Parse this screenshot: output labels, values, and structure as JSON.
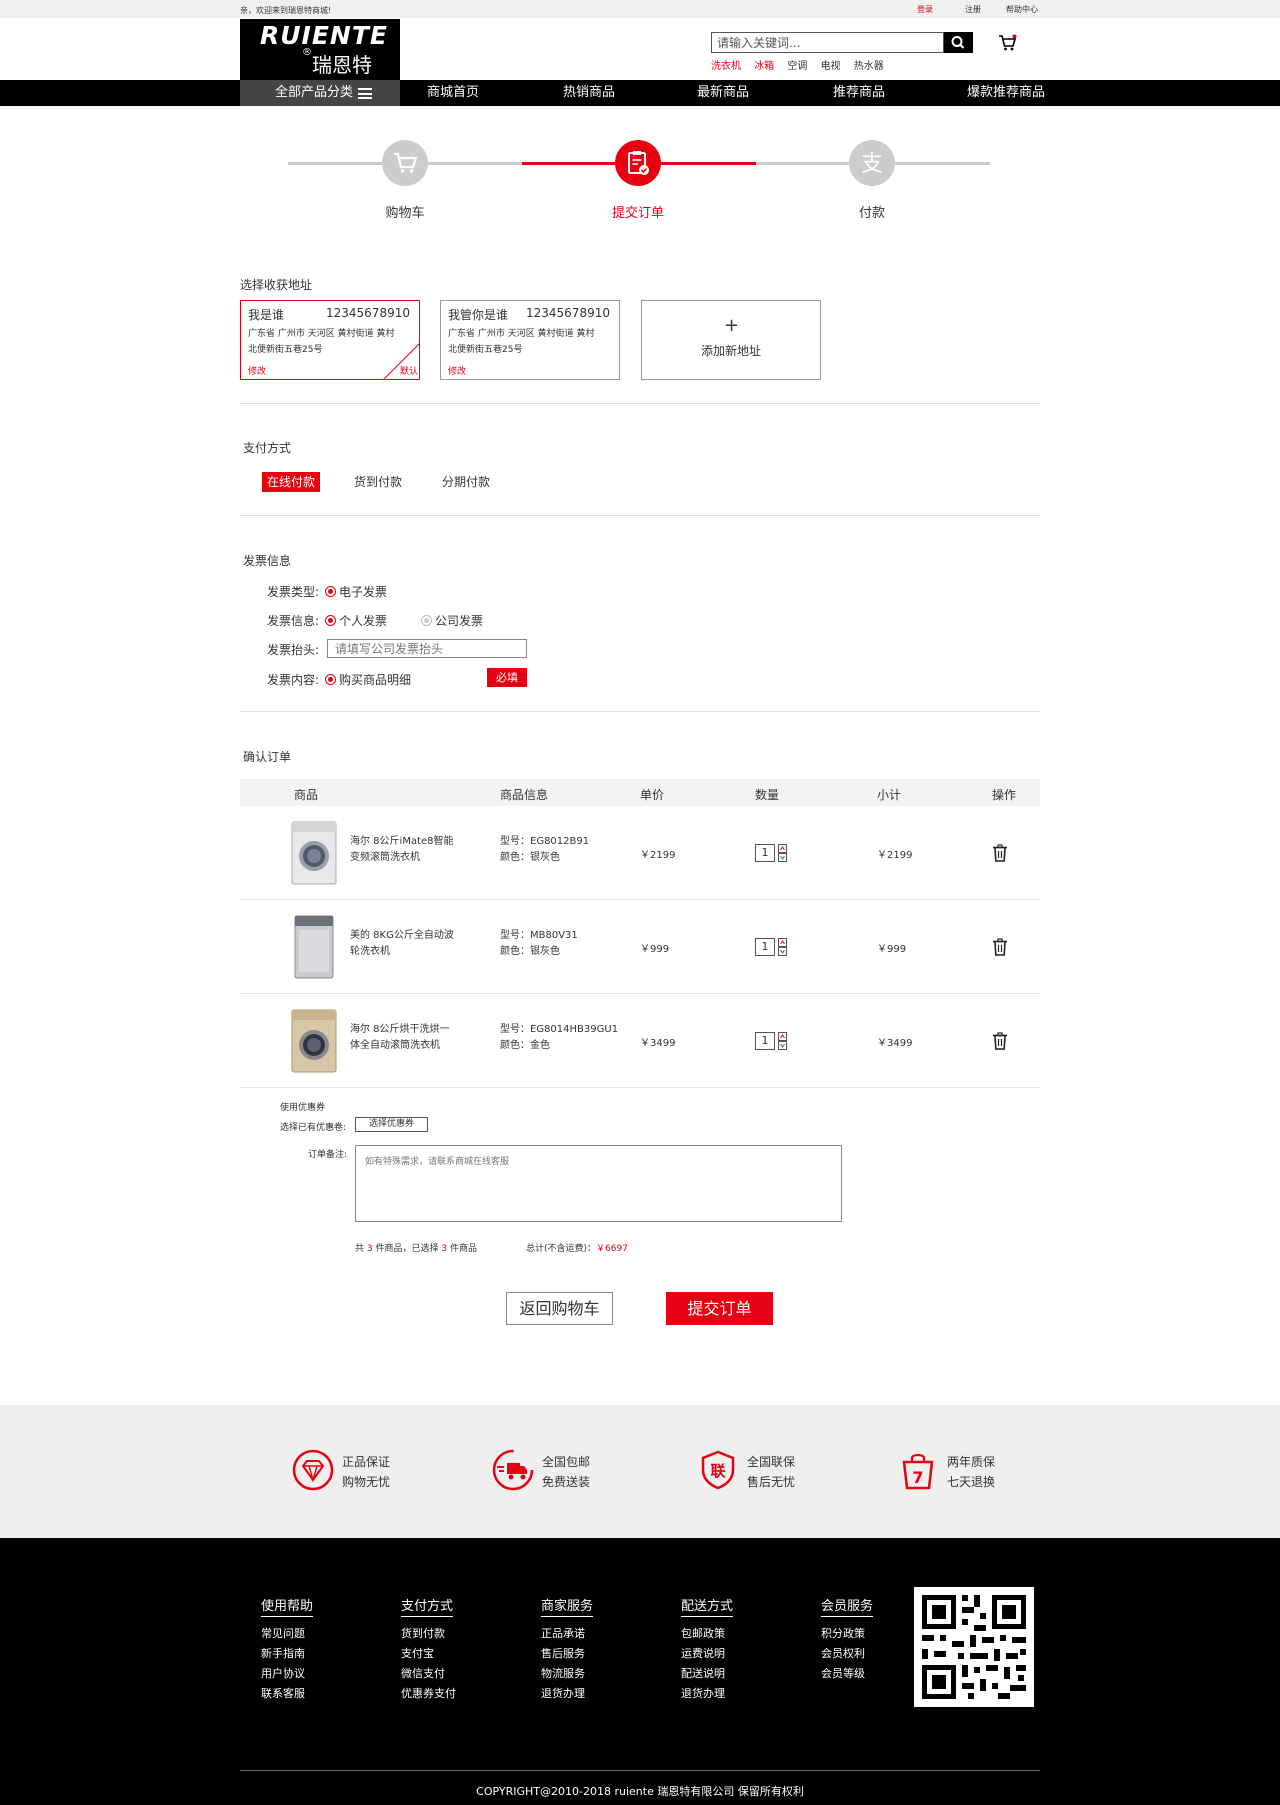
{
  "topbar": {
    "welcome": "亲，欢迎来到瑞恩特商城!",
    "login": "登录",
    "register": "注册",
    "help": "帮助中心"
  },
  "header": {
    "logo_en": "RUIENTE",
    "logo_zh": "瑞恩特",
    "logo_reg": "®",
    "search_placeholder": "请输入关键词...",
    "hot_links": [
      "洗衣机",
      "冰箱",
      "空调",
      "电视",
      "热水器"
    ]
  },
  "nav": {
    "category": "全部产品分类",
    "items": [
      "商城首页",
      "热销商品",
      "最新商品",
      "推荐商品",
      "爆款推荐商品"
    ],
    "active_index": 0
  },
  "steps": {
    "items": [
      "购物车",
      "提交订单",
      "付款"
    ],
    "active_index": 1
  },
  "address": {
    "title": "选择收获地址",
    "cards": [
      {
        "name": "我是谁",
        "phone": "12345678910",
        "line1": "广东省 广州市 天河区 黄村街道 黄村",
        "line2": "北便新街五巷25号",
        "edit": "修改",
        "default": "默认"
      },
      {
        "name": "我管你是谁",
        "phone": "12345678910",
        "line1": "广东省 广州市 天河区 黄村街道 黄村",
        "line2": "北便新街五巷25号",
        "edit": "修改"
      }
    ],
    "add_label": "添加新地址"
  },
  "payment": {
    "title": "支付方式",
    "options": [
      "在线付款",
      "货到付款",
      "分期付款"
    ],
    "selected_index": 0
  },
  "invoice": {
    "title": "发票信息",
    "type_label": "发票类型:",
    "type_value": "电子发票",
    "info_label": "发票信息:",
    "info_personal": "个人发票",
    "info_company": "公司发票",
    "header_label": "发票抬头:",
    "header_placeholder": "请填写公司发票抬头",
    "content_label": "发票内容:",
    "content_value": "购买商品明细",
    "required": "必填"
  },
  "order": {
    "title": "确认订单",
    "columns": [
      "商品",
      "商品信息",
      "单价",
      "数量",
      "小计",
      "操作"
    ],
    "items": [
      {
        "name_l1": "海尔 8公斤iMate8智能",
        "name_l2": "变频滚筒洗衣机",
        "model": "型号：EG8012B91",
        "color": "颜色：银灰色",
        "price": "￥2199",
        "qty": "1",
        "subtotal": "￥2199",
        "thumb": "front-loader-silver"
      },
      {
        "name_l1": "美的 8KG公斤全自动波",
        "name_l2": "轮洗衣机",
        "model": "型号：MB80V31",
        "color": "颜色：银灰色",
        "price": "￥999",
        "qty": "1",
        "subtotal": "￥999",
        "thumb": "top-loader-silver"
      },
      {
        "name_l1": "海尔 8公斤烘干洗烘一",
        "name_l2": "体全自动滚筒洗衣机",
        "model": "型号：EG8014HB39GU1",
        "color": "颜色：金色",
        "price": "￥3499",
        "qty": "1",
        "subtotal": "￥3499",
        "thumb": "front-loader-gold"
      }
    ]
  },
  "coupon": {
    "title": "使用优惠券",
    "label": "选择已有优惠卷:",
    "button": "选择优惠券"
  },
  "remark": {
    "label": "订单备注:",
    "placeholder": "如有特殊需求，请联系商城在线客服"
  },
  "summary": {
    "prefix": "共",
    "count": "3",
    "mid": "件商品，已选择",
    "selected": "3",
    "suffix": "件商品",
    "total_label": "总计(不含运费)：",
    "total_value": "￥6697"
  },
  "actions": {
    "back": "返回购物车",
    "submit": "提交订单"
  },
  "guarantees": [
    {
      "t1": "正品保证",
      "t2": "购物无忧",
      "icon": "diamond-icon"
    },
    {
      "t1": "全国包邮",
      "t2": "免费送装",
      "icon": "delivery-truck-icon"
    },
    {
      "t1": "全国联保",
      "t2": "售后无忧",
      "icon": "shield-icon"
    },
    {
      "t1": "两年质保",
      "t2": "七天退换",
      "icon": "shopping-bag-icon"
    }
  ],
  "footer": {
    "columns": [
      {
        "heading": "使用帮助",
        "items": [
          "常见问题",
          "新手指南",
          "用户协议",
          "联系客服"
        ]
      },
      {
        "heading": "支付方式",
        "items": [
          "货到付款",
          "支付宝",
          "微信支付",
          "优惠券支付"
        ]
      },
      {
        "heading": "商家服务",
        "items": [
          "正品承诺",
          "售后服务",
          "物流服务",
          "退货办理"
        ]
      },
      {
        "heading": "配送方式",
        "items": [
          "包邮政策",
          "运费说明",
          "配送说明",
          "退货办理"
        ]
      },
      {
        "heading": "会员服务",
        "items": [
          "积分政策",
          "会员权利",
          "会员等级"
        ]
      }
    ],
    "copyright": "COPYRIGHT@2010-2018 ruiente 瑞恩特有限公司 保留所有权利"
  },
  "colors": {
    "accent": "#e60012",
    "nav_bg": "#000000",
    "footer_bg": "#000000"
  }
}
